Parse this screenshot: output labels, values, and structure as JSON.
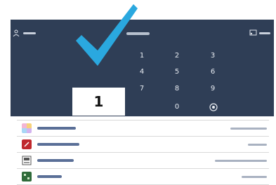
{
  "pin": {
    "digit": "1"
  },
  "keypad": {
    "keys": [
      "1",
      "2",
      "3",
      "4",
      "5",
      "6",
      "7",
      "8",
      "9",
      "0"
    ]
  },
  "colors": {
    "panel": "#2f3e56",
    "checkmark": "#2aa8df",
    "list_text": "#5a6f97"
  },
  "icons": {
    "top_left": "user-icon",
    "top_right": "cast-icon",
    "confirm": "radio-confirm-icon"
  },
  "rows": [
    {
      "icon": "colorful-app-icon"
    },
    {
      "icon": "red-app-icon"
    },
    {
      "icon": "printer-app-icon"
    },
    {
      "icon": "green-app-icon"
    }
  ]
}
